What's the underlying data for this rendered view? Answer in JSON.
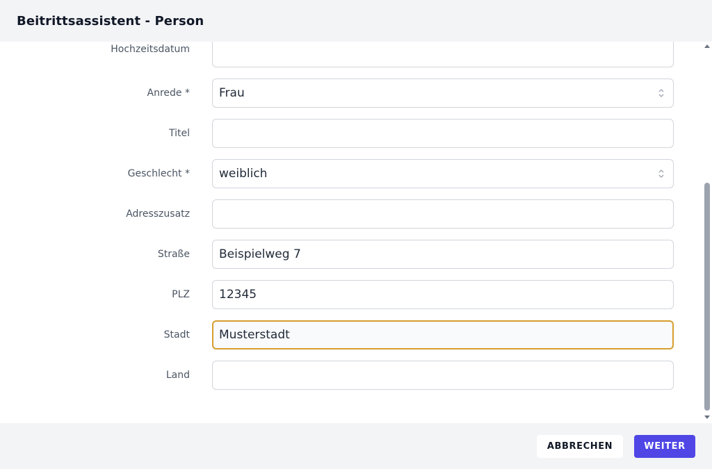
{
  "dialog": {
    "title": "Beitrittsassistent - Person"
  },
  "form": {
    "fields": [
      {
        "label": "Hochzeitsdatum",
        "value": ""
      },
      {
        "label": "Anrede *",
        "value": "Frau"
      },
      {
        "label": "Titel",
        "value": ""
      },
      {
        "label": "Geschlecht *",
        "value": "weiblich"
      },
      {
        "label": "Adresszusatz",
        "value": ""
      },
      {
        "label": "Straße",
        "value": "Beispielweg 7"
      },
      {
        "label": "PLZ",
        "value": "12345"
      },
      {
        "label": "Stadt",
        "value": "Musterstadt"
      },
      {
        "label": "Land",
        "value": ""
      }
    ]
  },
  "footer": {
    "cancel_label": "ABBRECHEN",
    "next_label": "WEITER"
  },
  "colors": {
    "accent": "#4f46e5",
    "focus_border": "#d69e2e",
    "header_bg": "#f3f4f6"
  }
}
